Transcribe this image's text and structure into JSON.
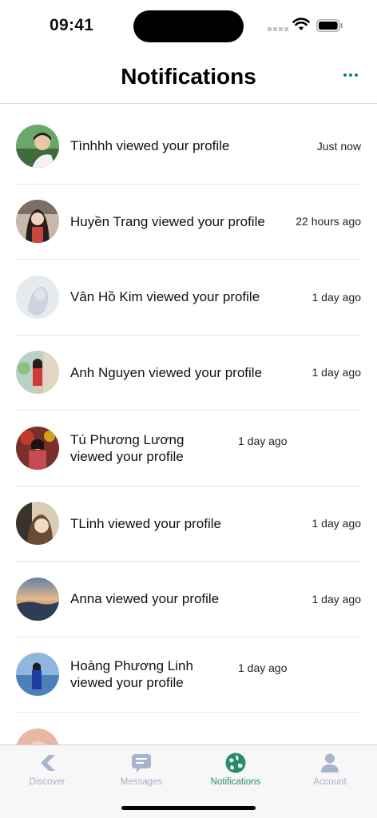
{
  "status": {
    "time": "09:41"
  },
  "header": {
    "title": "Notifications"
  },
  "notifications": [
    {
      "text": "Tìnhhh viewed your profile",
      "time": "Just now"
    },
    {
      "text": "Huyền Trang viewed your profile",
      "time": "22 hours ago"
    },
    {
      "text": "Vân Hồ Kim viewed your profile",
      "time": "1 day ago"
    },
    {
      "text": "Anh Nguyen viewed your profile",
      "time": "1 day ago"
    },
    {
      "text": "Tú Phương Lương viewed your profile",
      "time": "1 day ago"
    },
    {
      "text": "TLinh viewed your profile",
      "time": "1 day ago"
    },
    {
      "text": "Anna viewed your profile",
      "time": "1 day ago"
    },
    {
      "text": "Hoàng Phương Linh viewed your profile",
      "time": "1 day ago"
    }
  ],
  "tabs": [
    {
      "label": "Discover",
      "icon": "discover-icon"
    },
    {
      "label": "Messages",
      "icon": "messages-icon"
    },
    {
      "label": "Notifications",
      "icon": "notifications-icon"
    },
    {
      "label": "Account",
      "icon": "account-icon"
    }
  ],
  "colors": {
    "accent": "#0e7c84",
    "active_tab": "#2a8a6e",
    "inactive_tab": "#a8b0c4"
  }
}
